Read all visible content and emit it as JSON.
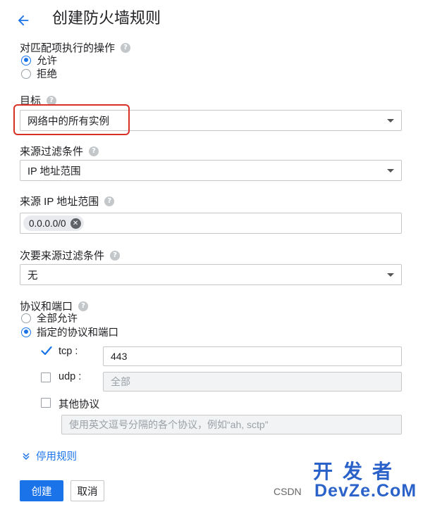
{
  "header": {
    "title": "创建防火墙规则"
  },
  "action": {
    "label": "对匹配项执行的操作",
    "options": [
      {
        "label": "允许",
        "selected": true
      },
      {
        "label": "拒绝",
        "selected": false
      }
    ]
  },
  "target": {
    "label": "目标",
    "value": "网络中的所有实例"
  },
  "source_filter": {
    "label": "来源过滤条件",
    "value": "IP 地址范围"
  },
  "source_ip": {
    "label": "来源 IP 地址范围",
    "chips": [
      "0.0.0.0/0"
    ]
  },
  "secondary_filter": {
    "label": "次要来源过滤条件",
    "value": "无"
  },
  "protocols": {
    "label": "协议和端口",
    "options": [
      {
        "label": "全部允许",
        "selected": false
      },
      {
        "label": "指定的协议和端口",
        "selected": true
      }
    ],
    "tcp": {
      "label": "tcp :",
      "checked": true,
      "value": "443"
    },
    "udp": {
      "label": "udp :",
      "checked": false,
      "placeholder": "全部"
    },
    "other": {
      "label": "其他协议",
      "checked": false,
      "placeholder": "使用英文逗号分隔的各个协议，例如“ah, sctp”"
    }
  },
  "disable_rule": {
    "label": "停用规则"
  },
  "buttons": {
    "create": "创建",
    "cancel": "取消"
  },
  "watermark": {
    "big": "开发者",
    "small": "CSDN",
    "brand": "DevZe.CoM"
  },
  "colors": {
    "accent": "#1a73e8",
    "highlight": "#d93025"
  },
  "icons": {
    "back": "arrow-left-icon",
    "help": "help-circle-icon",
    "dropdown": "caret-down-icon",
    "remove": "close-circle-icon",
    "expand": "chevron-double-down-icon",
    "check": "checkmark-icon"
  }
}
